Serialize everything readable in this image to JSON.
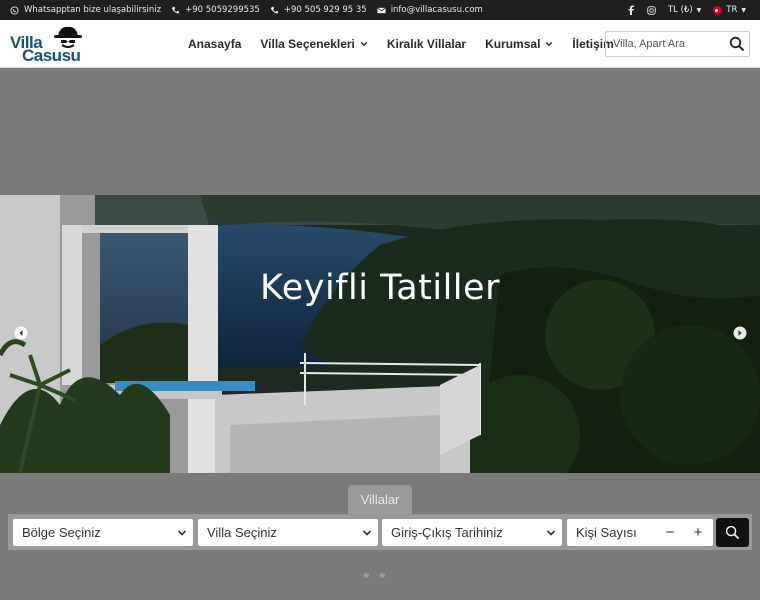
{
  "topbar": {
    "whatsapp_text": "Whatsapptan bize ulaşabilirsiniz",
    "phone1": "+90 5059299535",
    "phone2": "+90 505 929 95 35",
    "email": "info@villacasusu.com",
    "currency": "TL (₺)",
    "language": "TR"
  },
  "header": {
    "logo_line1": "Villa",
    "logo_line2": "Casusu",
    "nav": [
      {
        "label": "Anasayfa"
      },
      {
        "label": "Villa Seçenekleri"
      },
      {
        "label": "Kiralık Villalar"
      },
      {
        "label": "Kurumsal"
      },
      {
        "label": "İletişim"
      }
    ],
    "search_placeholder": "Villa, Apart Ara"
  },
  "hero": {
    "title": "Keyifli Tatiller"
  },
  "booking": {
    "tab_label": "Villalar",
    "region": "Bölge Seçiniz",
    "villa": "Villa Seçiniz",
    "dates": "Giriş-Çıkış Tarihiniz",
    "guests": "Kişi Sayısı",
    "minus": "−",
    "plus": "+"
  },
  "colors": {
    "topbar_bg": "#1f1f1f",
    "brand": "#1c4f7a",
    "panel_bg": "#999999",
    "search_button": "#111111"
  }
}
